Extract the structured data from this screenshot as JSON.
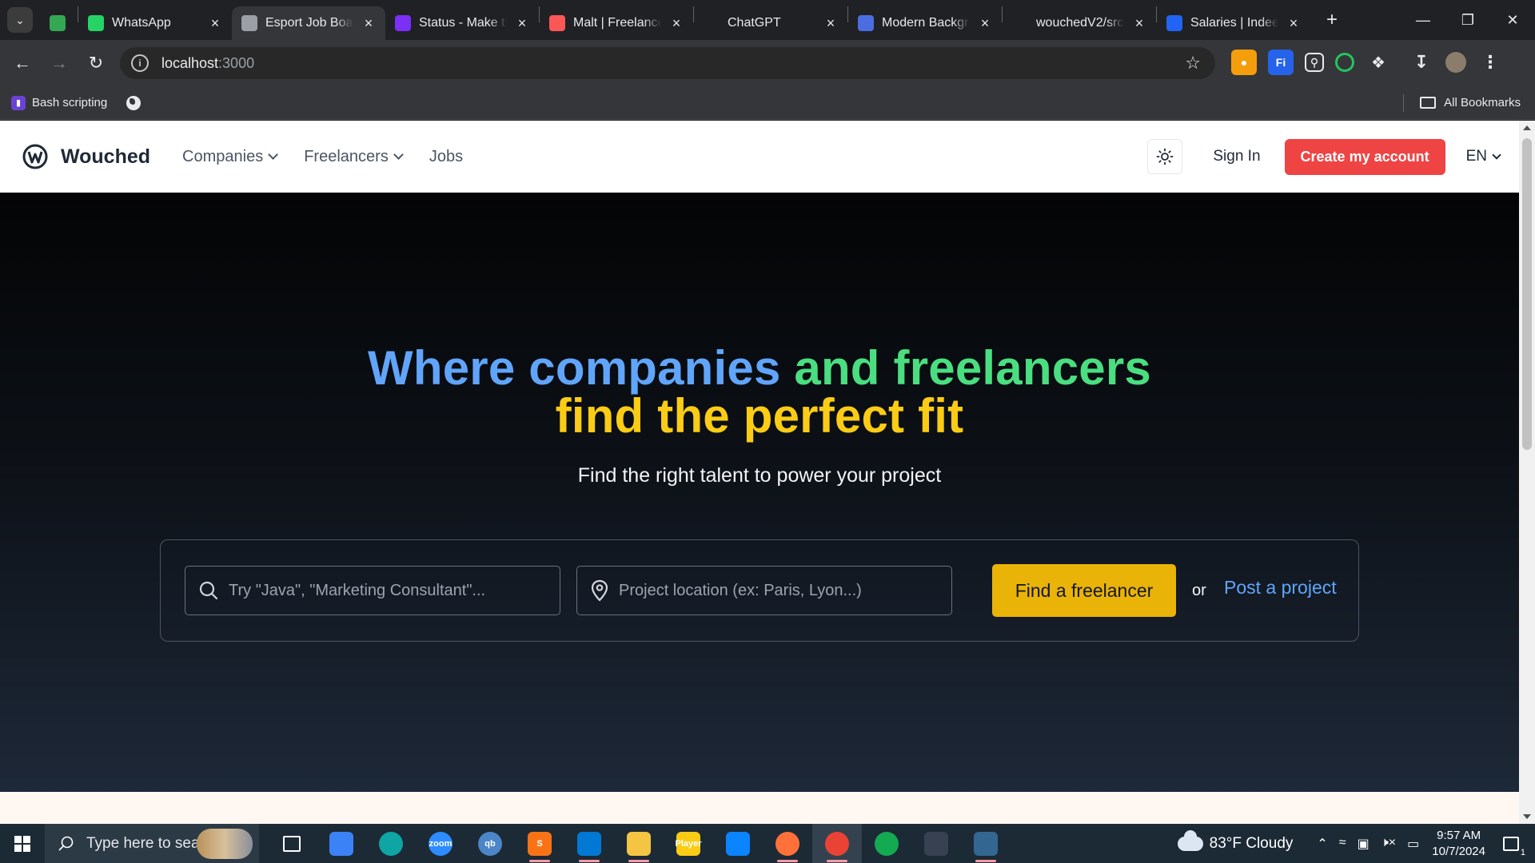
{
  "browser": {
    "tabs": [
      {
        "type": "pinned",
        "icon": "google-drive-icon",
        "color": "#34a853"
      },
      {
        "type": "normal",
        "label": "WhatsApp",
        "icon": "whatsapp-icon",
        "color": "#25d366"
      },
      {
        "type": "normal",
        "label": "Esport Job Boar",
        "icon": "globe-icon",
        "color": "#9aa0a6",
        "active": true
      },
      {
        "type": "normal",
        "label": "Status - Make th",
        "icon": "make-icon",
        "color": "#7b2ff7"
      },
      {
        "type": "normal",
        "label": "Malt | Freelance",
        "icon": "malt-icon",
        "color": "#fc5757"
      },
      {
        "type": "normal",
        "label": "ChatGPT",
        "icon": "chatgpt-icon",
        "color": "#202124"
      },
      {
        "type": "normal",
        "label": "Modern Backgr",
        "icon": "docs-icon",
        "color": "#4a6ee0"
      },
      {
        "type": "normal",
        "label": "wouchedV2/src",
        "icon": "github-icon",
        "color": "#202124"
      },
      {
        "type": "normal",
        "label": "Salaries | Indeed",
        "icon": "indeed-icon",
        "color": "#2164f3"
      }
    ],
    "url_host": "localhost",
    "url_port": ":3000",
    "bookmarks": [
      {
        "label": "Bash scripting",
        "icon": "bash-icon"
      }
    ],
    "all_bookmarks_label": "All Bookmarks"
  },
  "site": {
    "brand": "Wouched",
    "nav": [
      {
        "label": "Companies",
        "has_menu": true
      },
      {
        "label": "Freelancers",
        "has_menu": true
      },
      {
        "label": "Jobs",
        "has_menu": false
      }
    ],
    "sign_in": "Sign In",
    "cta": "Create my account",
    "language": "EN",
    "hero": {
      "title_parts": [
        {
          "text": "Where companies ",
          "color": "#60a5fa"
        },
        {
          "text": "and freelancers",
          "color": "#4ade80"
        },
        {
          "text": "find the perfect fit",
          "color": "#facc15"
        }
      ],
      "subtitle": "Find the right talent to power your project",
      "search_placeholder": "Try \"Java\", \"Marketing Consultant\"...",
      "location_placeholder": "Project location (ex: Paris, Lyon...)",
      "find_button": "Find a freelancer",
      "or": "or",
      "post_link": "Post a project"
    },
    "colors": {
      "cta_red": "#ef4444",
      "find_yellow": "#eab308",
      "link_blue": "#60a5fa"
    }
  },
  "taskbar": {
    "search_placeholder": "Type here to search",
    "apps": [
      {
        "name": "task-view",
        "label": "",
        "color": "transparent"
      },
      {
        "name": "microsoft-store",
        "label": "",
        "color": "#3b82f6"
      },
      {
        "name": "edge",
        "label": "",
        "color": "#0ea5a4"
      },
      {
        "name": "zoom",
        "label": "zoom",
        "color": "#2d8cff"
      },
      {
        "name": "qbittorrent",
        "label": "qb",
        "color": "#4a86c8"
      },
      {
        "name": "sublime-text",
        "label": "S",
        "color": "#f97316",
        "running": true
      },
      {
        "name": "vscode",
        "label": "",
        "color": "#0078d4",
        "running": true
      },
      {
        "name": "file-explorer",
        "label": "",
        "color": "#f4c542",
        "running": true
      },
      {
        "name": "potplayer",
        "label": "Player",
        "color": "#facc15"
      },
      {
        "name": "mail",
        "label": "",
        "color": "#0a84ff"
      },
      {
        "name": "firefox",
        "label": "",
        "color": "#ff7139",
        "running": true
      },
      {
        "name": "chrome",
        "label": "",
        "color": "#ea4335",
        "running": true,
        "active": true
      },
      {
        "name": "mongodb",
        "label": "",
        "color": "#13aa52"
      },
      {
        "name": "screen-recorder",
        "label": "",
        "color": "#374151"
      },
      {
        "name": "postgresql",
        "label": "",
        "color": "#336791",
        "running": true
      }
    ],
    "weather": "83°F  Cloudy",
    "time": "9:57 AM",
    "date": "10/7/2024",
    "notifications": "1"
  }
}
